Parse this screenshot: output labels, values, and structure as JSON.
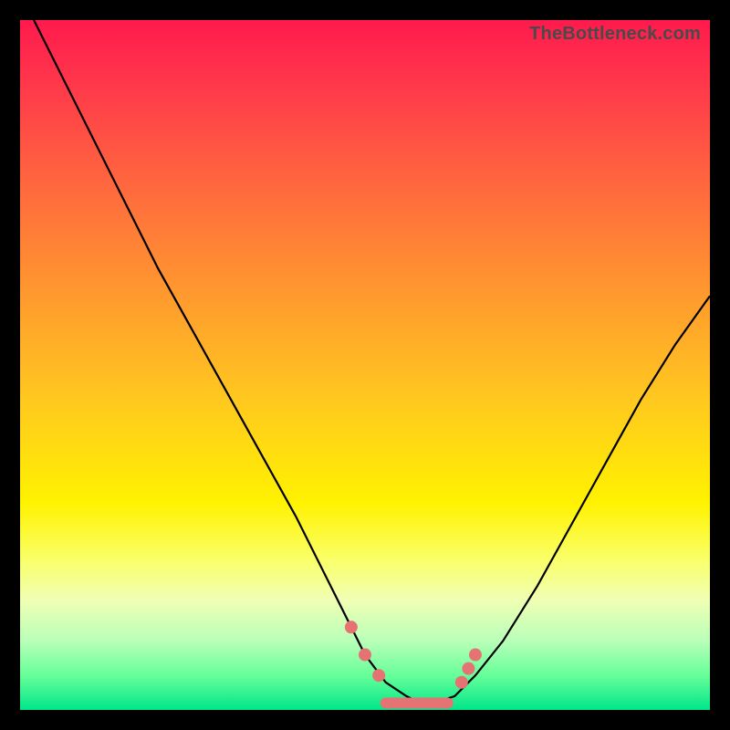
{
  "watermark": "TheBottleneck.com",
  "colors": {
    "frame": "#000000",
    "marker": "#e57373",
    "curve": "#000000",
    "gradient_top": "#ff1a4d",
    "gradient_bottom": "#00e68a"
  },
  "chart_data": {
    "type": "line",
    "title": "",
    "xlabel": "",
    "ylabel": "",
    "xlim": [
      0,
      100
    ],
    "ylim": [
      0,
      100
    ],
    "grid": false,
    "legend": false,
    "series": [
      {
        "name": "bottleneck-curve",
        "x": [
          2,
          5,
          10,
          15,
          20,
          25,
          30,
          35,
          40,
          45,
          48,
          50,
          53,
          56,
          58,
          60,
          63,
          66,
          70,
          75,
          80,
          85,
          90,
          95,
          100
        ],
        "values": [
          100,
          94,
          84,
          74,
          64,
          55,
          46,
          37,
          28,
          18,
          12,
          8,
          4,
          2,
          1,
          1,
          2,
          5,
          10,
          18,
          27,
          36,
          45,
          53,
          60
        ]
      }
    ],
    "markers": [
      {
        "x": 48,
        "y": 12
      },
      {
        "x": 50,
        "y": 8
      },
      {
        "x": 52,
        "y": 5
      },
      {
        "x": 64,
        "y": 4
      },
      {
        "x": 65,
        "y": 6
      },
      {
        "x": 66,
        "y": 8
      }
    ],
    "trough_bar": {
      "x_start": 53,
      "x_end": 62,
      "y": 1
    }
  }
}
